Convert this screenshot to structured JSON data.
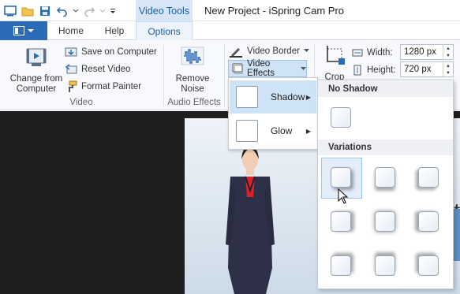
{
  "titlebar": {
    "context_tab": "Video Tools",
    "document_title": "New Project - iSpring Cam Pro"
  },
  "qat": {
    "icons": [
      "app-icon",
      "open-folder-icon",
      "save-icon",
      "undo-icon",
      "dropdown-arrow-icon",
      "redo-icon",
      "dropdown-arrow-icon",
      "customize-qat-icon"
    ]
  },
  "tabs": {
    "home": "Home",
    "help": "Help",
    "options": "Options"
  },
  "ribbon": {
    "video_group": {
      "label": "Video",
      "change_from_computer": "Change from Computer",
      "save_on_computer": "Save on Computer",
      "reset_video": "Reset Video",
      "format_painter": "Format Painter"
    },
    "audio_group": {
      "label": "Audio Effects",
      "remove_noise": "Remove Noise"
    },
    "video_border": "Video Border",
    "video_effects": "Video Effects",
    "crop": "Crop",
    "width_label": "Width:",
    "width_value": "1280 px",
    "height_label": "Height:",
    "height_value": "720 px"
  },
  "effects_menu": {
    "items": [
      {
        "label": "Shadow",
        "highlighted": true
      },
      {
        "label": "Glow",
        "highlighted": false
      }
    ]
  },
  "shadow_gallery": {
    "no_shadow_header": "No Shadow",
    "variations_header": "Variations",
    "variation_count": 9,
    "selected_index": 0
  },
  "colors": {
    "accent": "#2b6cb8",
    "highlight": "#cfe3f6",
    "workspace": "#1f1f1f"
  }
}
